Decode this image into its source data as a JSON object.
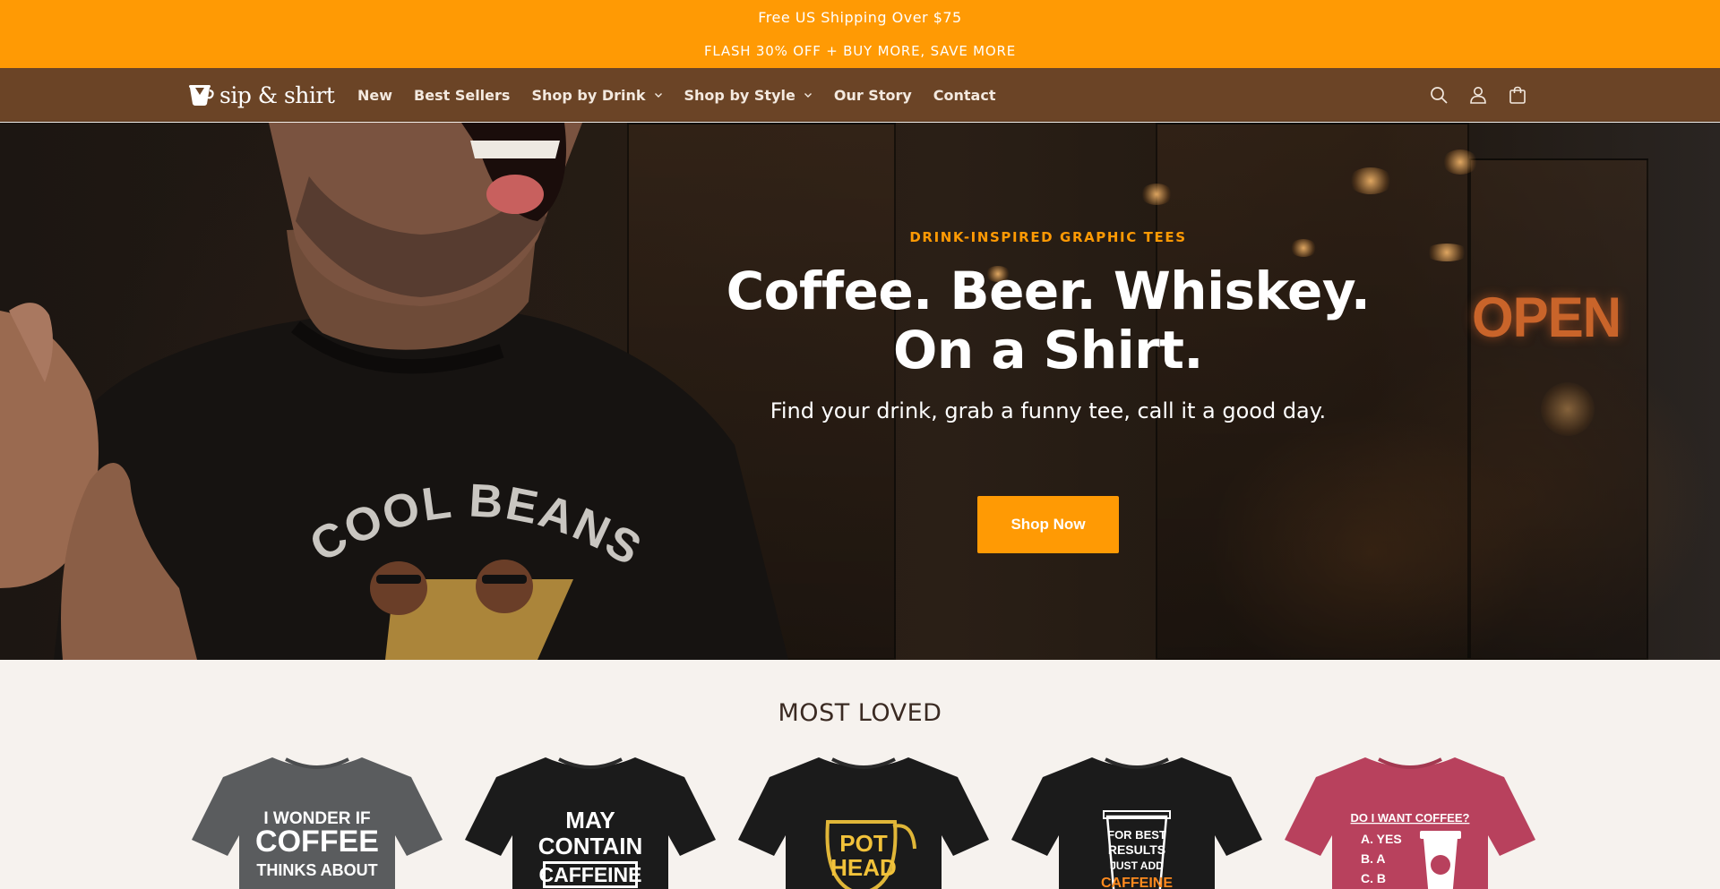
{
  "announcement": {
    "line1": "Free US Shipping Over $75",
    "line2": "FLASH 30% OFF + BUY MORE, SAVE MORE"
  },
  "brand": {
    "name": "sip & shirt",
    "colors": {
      "accent": "#ff9a04",
      "header": "#6b4426",
      "page_bg": "#f6f2ee"
    }
  },
  "nav": {
    "items": [
      {
        "label": "New",
        "has_dropdown": false
      },
      {
        "label": "Best Sellers",
        "has_dropdown": false
      },
      {
        "label": "Shop by Drink",
        "has_dropdown": true
      },
      {
        "label": "Shop by Style",
        "has_dropdown": true
      },
      {
        "label": "Our Story",
        "has_dropdown": false
      },
      {
        "label": "Contact",
        "has_dropdown": false
      }
    ],
    "icons": [
      "search-icon",
      "account-icon",
      "cart-icon"
    ]
  },
  "hero": {
    "kicker": "DRINK-INSPIRED GRAPHIC TEES",
    "heading_line1": "Coffee. Beer. Whiskey.",
    "heading_line2": "On a Shirt.",
    "subheading": "Find your drink, grab a funny tee, call it a good day.",
    "cta": "Shop Now",
    "shirt_print": "COOL BEANS",
    "sign_text": "OPEN"
  },
  "most_loved": {
    "title": "MOST LOVED",
    "products": [
      {
        "color": "#5a5c5e",
        "lines": [
          "I WONDER IF",
          "COFFEE",
          "THINKS ABOUT"
        ]
      },
      {
        "color": "#1b1b1b",
        "lines": [
          "MAY",
          "CONTAIN",
          "CAFFEINE"
        ]
      },
      {
        "color": "#1b1b1b",
        "lines": [
          "POT",
          "HEAD"
        ]
      },
      {
        "color": "#1b1b1b",
        "lines": [
          "FOR BEST",
          "RESULTS",
          "JUST ADD",
          "CAFFEINE"
        ]
      },
      {
        "color": "#b8415d",
        "lines": [
          "DO I WANT COFFEE?",
          "A. YES",
          "B. A",
          "C. B"
        ]
      }
    ]
  }
}
